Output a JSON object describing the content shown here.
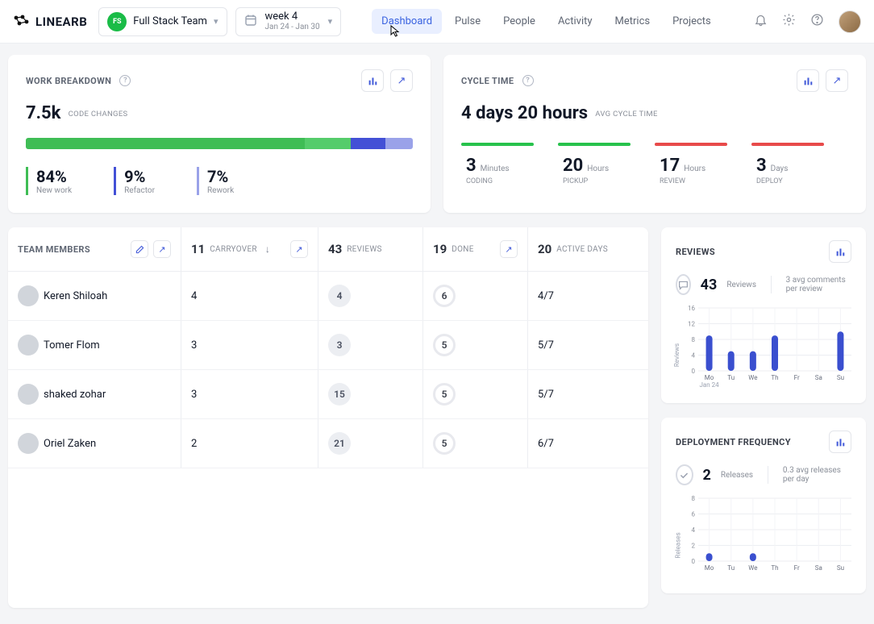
{
  "brand": "LINEARB",
  "header": {
    "team_badge": "FS",
    "team_name": "Full Stack Team",
    "date_primary": "week 4",
    "date_secondary": "Jan 24 - Jan 30",
    "nav": [
      "Dashboard",
      "Pulse",
      "People",
      "Activity",
      "Metrics",
      "Projects"
    ],
    "active_nav_index": 0
  },
  "work_breakdown": {
    "title": "WORK BREAKDOWN",
    "total_value": "7.5k",
    "total_label": "CODE CHANGES",
    "segments_pct": [
      72,
      12,
      9,
      7
    ],
    "stats": [
      {
        "pct": "84%",
        "label": "New work"
      },
      {
        "pct": "9%",
        "label": "Refactor"
      },
      {
        "pct": "7%",
        "label": "Rework"
      }
    ]
  },
  "cycle_time": {
    "title": "CYCLE TIME",
    "headline": "4 days 20 hours",
    "headline_label": "AVG CYCLE TIME",
    "segments": [
      {
        "num": "3",
        "unit": "Minutes",
        "label": "CODING",
        "color": "green"
      },
      {
        "num": "20",
        "unit": "Hours",
        "label": "PICKUP",
        "color": "green"
      },
      {
        "num": "17",
        "unit": "Hours",
        "label": "REVIEW",
        "color": "red"
      },
      {
        "num": "3",
        "unit": "Days",
        "label": "DEPLOY",
        "color": "red"
      }
    ]
  },
  "team_table": {
    "headers": {
      "name": "TEAM MEMBERS",
      "carry_num": "11",
      "carry_lbl": "CARRYOVER",
      "rev_num": "43",
      "rev_lbl": "REVIEWS",
      "done_num": "19",
      "done_lbl": "DONE",
      "act_num": "20",
      "act_lbl": "ACTIVE DAYS"
    },
    "rows": [
      {
        "name": "Keren Shiloah",
        "carry": "4",
        "rev": "4",
        "done": "6",
        "active": "4/7"
      },
      {
        "name": "Tomer Flom",
        "carry": "3",
        "rev": "3",
        "done": "5",
        "active": "5/7"
      },
      {
        "name": "shaked zohar",
        "carry": "3",
        "rev": "15",
        "done": "5",
        "active": "5/7"
      },
      {
        "name": "Oriel Zaken",
        "carry": "2",
        "rev": "21",
        "done": "5",
        "active": "6/7"
      }
    ]
  },
  "reviews": {
    "title": "REVIEWS",
    "num": "43",
    "num_lbl": "Reviews",
    "sub": "3 avg comments per review",
    "y_max": 16,
    "y_label": "Reviews",
    "x_sub": "Jan 24"
  },
  "deployment": {
    "title": "DEPLOYMENT FREQUENCY",
    "num": "2",
    "num_lbl": "Releases",
    "sub": "0.3 avg releases per day",
    "y_max": 8,
    "y_label": "Releases"
  },
  "chart_data": [
    {
      "type": "bar",
      "title": "Reviews",
      "categories": [
        "Mo",
        "Tu",
        "We",
        "Th",
        "Fr",
        "Sa",
        "Su"
      ],
      "values": [
        9,
        5,
        5,
        9,
        0,
        0,
        10
      ],
      "ylim": [
        0,
        16
      ],
      "ylabel": "Reviews",
      "x_sublabel_first": "Jan 24"
    },
    {
      "type": "bar",
      "title": "Deployment Frequency",
      "categories": [
        "Mo",
        "Tu",
        "We",
        "Th",
        "Fr",
        "Sa",
        "Su"
      ],
      "values": [
        1,
        0,
        1,
        0,
        0,
        0,
        0
      ],
      "ylim": [
        0,
        8
      ],
      "ylabel": "Releases"
    }
  ]
}
